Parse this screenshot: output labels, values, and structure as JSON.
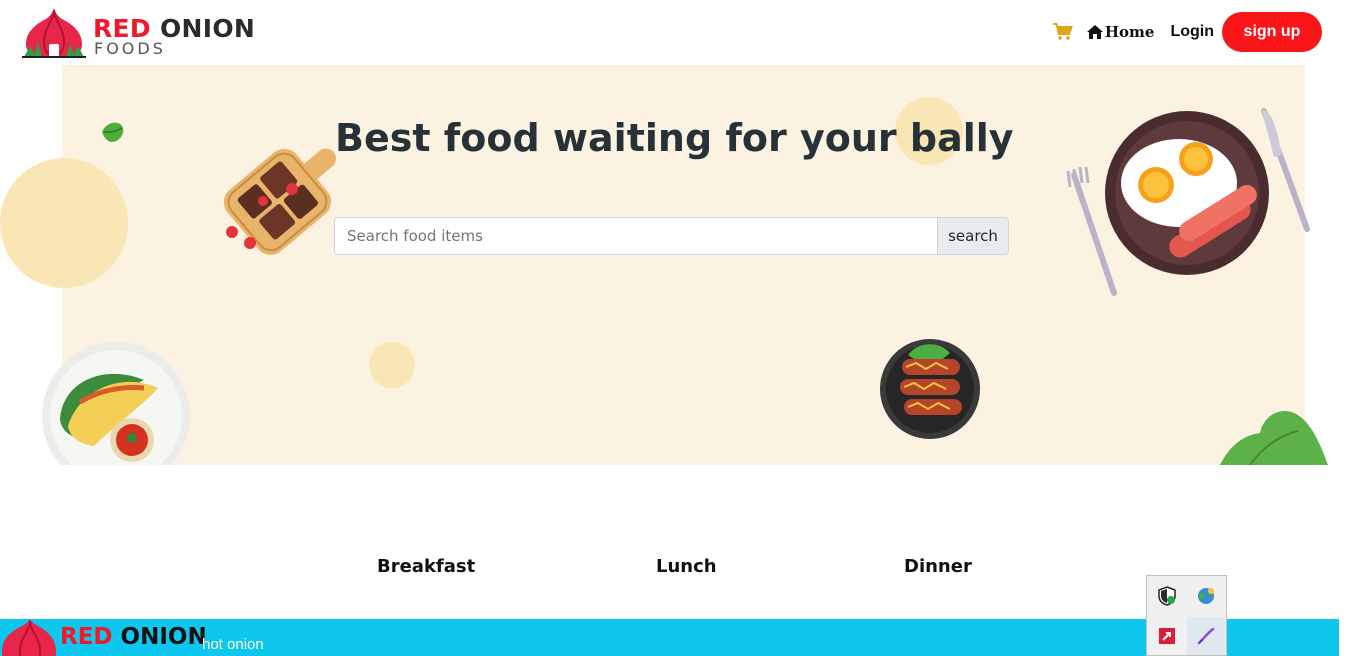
{
  "brand": {
    "name_red": "RED",
    "name_dark": "ONION",
    "sub": "FOODS"
  },
  "nav": {
    "home_label": "Home",
    "login_label": "Login",
    "signup_label": "sign up"
  },
  "hero": {
    "title": "Best food waiting for your bally",
    "search_placeholder": "Search food items",
    "search_button": "search"
  },
  "tabs": [
    {
      "label": "Breakfast"
    },
    {
      "label": "Lunch"
    },
    {
      "label": "Dinner"
    }
  ],
  "footer": {
    "brand_red": "RED",
    "brand_dark": "ONION",
    "tagline": "hot onion"
  },
  "icons": [
    "cart-icon",
    "home-icon",
    "onion-logo-icon",
    "shield-icon",
    "globe-icon",
    "app-icon",
    "pen-icon"
  ],
  "colors": {
    "accent": "#f91518",
    "hero_bg": "#fbf2e1",
    "footer_bg": "#0dc7ee",
    "cart": "#e0a418"
  }
}
